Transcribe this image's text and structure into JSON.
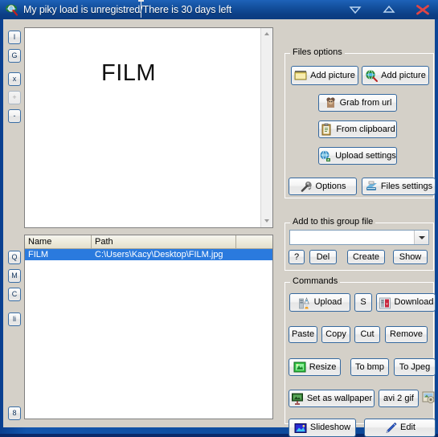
{
  "window": {
    "title": "My piky load is unregistred/There is 30 days left",
    "icon": "app-magnifier-icon",
    "controls": {
      "minimize": "minimize",
      "maximize": "maximize",
      "close": "close"
    }
  },
  "left_toolbar_top": [
    {
      "label": "I",
      "name": "tool-button-i",
      "disabled": false
    },
    {
      "label": "G",
      "name": "tool-button-g",
      "disabled": false
    },
    {
      "label": "x",
      "name": "tool-button-x",
      "disabled": false
    },
    {
      "label": "+",
      "name": "tool-button-plus",
      "disabled": true
    },
    {
      "label": "-",
      "name": "tool-button-minus",
      "disabled": false
    }
  ],
  "left_toolbar_bottom": [
    {
      "label": "Q",
      "name": "tool-button-q",
      "disabled": false
    },
    {
      "label": "M",
      "name": "tool-button-m",
      "disabled": false
    },
    {
      "label": "C",
      "name": "tool-button-c",
      "disabled": false
    },
    {
      "label": "li",
      "name": "tool-button-li",
      "disabled": false
    }
  ],
  "left_toolbar_footer": [
    {
      "label": "8",
      "name": "tool-button-8",
      "disabled": false
    }
  ],
  "preview": {
    "image_text": "FILM",
    "scrollbar": {
      "up": "scroll-up",
      "down": "scroll-down"
    }
  },
  "file_list": {
    "columns": [
      "Name",
      "Path",
      ""
    ],
    "rows": [
      {
        "name": "FILM",
        "path": "C:\\Users\\Kacy\\Desktop\\FILM.jpg",
        "extra": "",
        "selected": true
      }
    ]
  },
  "files_options": {
    "title": "Files options",
    "buttons": [
      {
        "label": "Add picture",
        "name": "add-picture-local-button",
        "icon": "folder-icon"
      },
      {
        "label": "Add picture",
        "name": "add-picture-web-button",
        "icon": "globe-search-icon"
      },
      {
        "label": "Grab from url",
        "name": "grab-from-url-button",
        "icon": "grabber-icon"
      },
      {
        "label": "From clipboard",
        "name": "from-clipboard-button",
        "icon": "clipboard-icon"
      },
      {
        "label": "Upload settings",
        "name": "upload-settings-button",
        "icon": "globe-upload-icon"
      },
      {
        "label": "Options",
        "name": "options-button",
        "icon": "wrench-icon"
      },
      {
        "label": "Files settings",
        "name": "files-settings-button",
        "icon": "files-settings-icon"
      }
    ]
  },
  "group_file": {
    "title": "Add to this group file",
    "combo_value": "",
    "combo_placeholder": "",
    "buttons": [
      {
        "label": "?",
        "name": "group-help-button"
      },
      {
        "label": "Del",
        "name": "group-del-button"
      },
      {
        "label": "Create",
        "name": "group-create-button"
      },
      {
        "label": "Show",
        "name": "group-show-button"
      }
    ]
  },
  "commands": {
    "title": "Commands",
    "row1": [
      {
        "label": "Upload",
        "name": "upload-button",
        "icon": "upload-icon"
      },
      {
        "label": "S",
        "name": "s-button",
        "icon": ""
      },
      {
        "label": "Download",
        "name": "download-button",
        "icon": "download-icon"
      }
    ],
    "row2": [
      {
        "label": "Paste",
        "name": "paste-button"
      },
      {
        "label": "Copy",
        "name": "copy-button"
      },
      {
        "label": "Cut",
        "name": "cut-button"
      },
      {
        "label": "Remove",
        "name": "remove-button"
      }
    ],
    "row3": [
      {
        "label": "Resize",
        "name": "resize-button",
        "icon": "resize-icon"
      },
      {
        "label": "To bmp",
        "name": "to-bmp-button",
        "icon": ""
      },
      {
        "label": "To Jpeg",
        "name": "to-jpeg-button",
        "icon": ""
      }
    ],
    "row4": [
      {
        "label": "Set as wallpaper",
        "name": "set-as-wallpaper-button",
        "icon": "wallpaper-icon"
      },
      {
        "label": "avi 2 gif",
        "name": "avi-2-gif-button",
        "icon": ""
      }
    ],
    "row4_extra_icon": {
      "name": "avi-2-gif-preview-icon"
    },
    "row5": [
      {
        "label": "Slideshow",
        "name": "slideshow-button",
        "icon": "slideshow-icon"
      },
      {
        "label": "Edit",
        "name": "edit-button",
        "icon": "pencil-icon"
      }
    ]
  },
  "colors": {
    "titlebar": "#0f4fa2",
    "panel": "#d4d0c8",
    "selection": "#2a7ade",
    "button_border": "#36699f",
    "close_x": "#e04545"
  }
}
